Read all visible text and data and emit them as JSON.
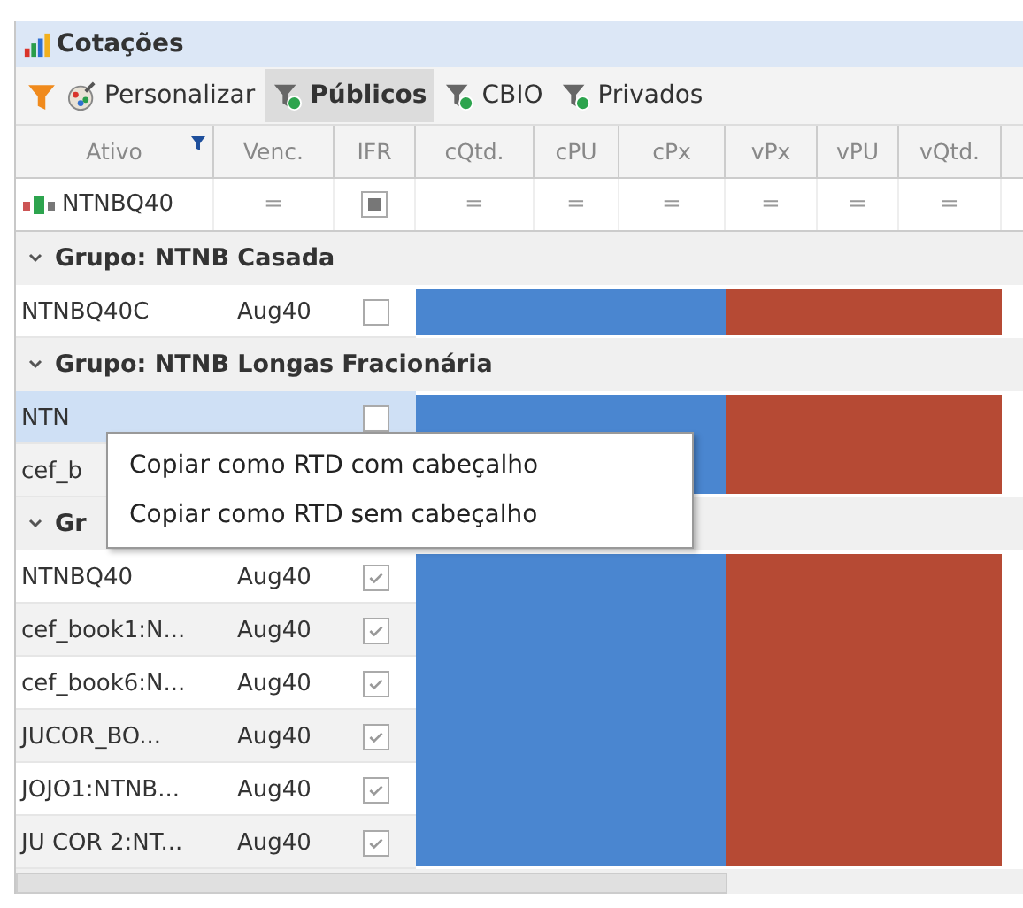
{
  "window": {
    "title": "Cotações"
  },
  "toolbar": {
    "customize": "Personalizar",
    "tabs": [
      {
        "label": "Públicos",
        "selected": true
      },
      {
        "label": "CBIO",
        "selected": false
      },
      {
        "label": "Privados",
        "selected": false
      }
    ]
  },
  "table": {
    "columns": [
      {
        "label": "Ativo",
        "filtered": true
      },
      {
        "label": "Venc.",
        "filtered": false
      },
      {
        "label": "IFR",
        "filtered": false
      },
      {
        "label": "cQtd.",
        "filtered": false
      },
      {
        "label": "cPU",
        "filtered": false
      },
      {
        "label": "cPx",
        "filtered": false
      },
      {
        "label": "vPx",
        "filtered": false
      },
      {
        "label": "vPU",
        "filtered": false
      },
      {
        "label": "vQtd.",
        "filtered": false
      }
    ],
    "filter_row": {
      "ativo": "NTNBQ40",
      "cells": [
        {
          "kind": "operator",
          "text": "="
        },
        {
          "kind": "checkbox",
          "indeterminate": true
        },
        {
          "kind": "operator",
          "text": "="
        },
        {
          "kind": "operator",
          "text": "="
        },
        {
          "kind": "operator",
          "text": "="
        },
        {
          "kind": "operator",
          "text": "="
        },
        {
          "kind": "operator",
          "text": "="
        },
        {
          "kind": "operator",
          "text": "="
        }
      ]
    },
    "groups": [
      {
        "title": "Grupo: NTNB Casada",
        "expanded": true,
        "rows": [
          {
            "ativo": "NTNBQ40C",
            "venc": "Aug40",
            "checked": false,
            "selected": false
          }
        ]
      },
      {
        "title": "Grupo: NTNB Longas Fracionária",
        "expanded": true,
        "rows": [
          {
            "ativo": "NTN",
            "checked": false,
            "selected": true
          },
          {
            "ativo": "cef_b",
            "selected": false
          }
        ]
      },
      {
        "title": "Gr",
        "expanded": true,
        "rows": [
          {
            "ativo": "NTNBQ40",
            "venc": "Aug40",
            "checked": true,
            "selected": false
          },
          {
            "ativo": "cef_book1:N...",
            "venc": "Aug40",
            "checked": true,
            "selected": false
          },
          {
            "ativo": "cef_book6:N...",
            "venc": "Aug40",
            "checked": true,
            "selected": false
          },
          {
            "ativo": "JUCOR_BO...",
            "venc": "Aug40",
            "checked": true,
            "selected": false
          },
          {
            "ativo": "JOJO1:NTNB...",
            "venc": "Aug40",
            "checked": true,
            "selected": false
          },
          {
            "ativo": "JU COR 2:NT...",
            "venc": "Aug40",
            "checked": true,
            "selected": false
          }
        ]
      }
    ]
  },
  "context_menu": {
    "items": [
      "Copiar como RTD com cabeçalho",
      "Copiar como RTD sem cabeçalho"
    ]
  }
}
